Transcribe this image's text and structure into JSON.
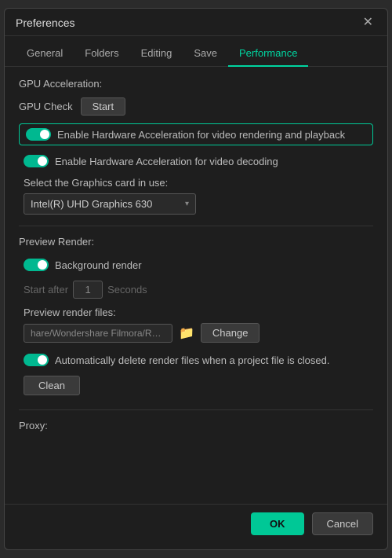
{
  "dialog": {
    "title": "Preferences",
    "close_label": "✕"
  },
  "tabs": [
    {
      "label": "General",
      "active": false
    },
    {
      "label": "Folders",
      "active": false
    },
    {
      "label": "Editing",
      "active": false
    },
    {
      "label": "Save",
      "active": false
    },
    {
      "label": "Performance",
      "active": true
    }
  ],
  "gpu_section": {
    "label": "GPU Acceleration:",
    "gpu_check_label": "GPU Check",
    "start_btn": "Start",
    "toggle1": {
      "label": "Enable Hardware Acceleration for video rendering and playback",
      "state": "on",
      "highlighted": true
    },
    "toggle2": {
      "label": "Enable Hardware Acceleration for video decoding",
      "state": "on",
      "highlighted": false
    },
    "graphics_label": "Select the Graphics card in use:",
    "graphics_value": "Intel(R) UHD Graphics 630"
  },
  "preview_section": {
    "label": "Preview Render:",
    "toggle_bg_render": {
      "label": "Background render",
      "state": "on"
    },
    "start_after_label": "Start after",
    "start_after_value": "1",
    "seconds_label": "Seconds",
    "preview_files_label": "Preview render files:",
    "file_path": "hare/Wondershare Filmora/Render",
    "change_btn": "Change",
    "toggle_auto_delete": {
      "label": "Automatically delete render files when a project file is closed.",
      "state": "on"
    },
    "clean_btn": "Clean"
  },
  "proxy_section": {
    "label": "Proxy:"
  },
  "footer": {
    "ok_label": "OK",
    "cancel_label": "Cancel"
  }
}
